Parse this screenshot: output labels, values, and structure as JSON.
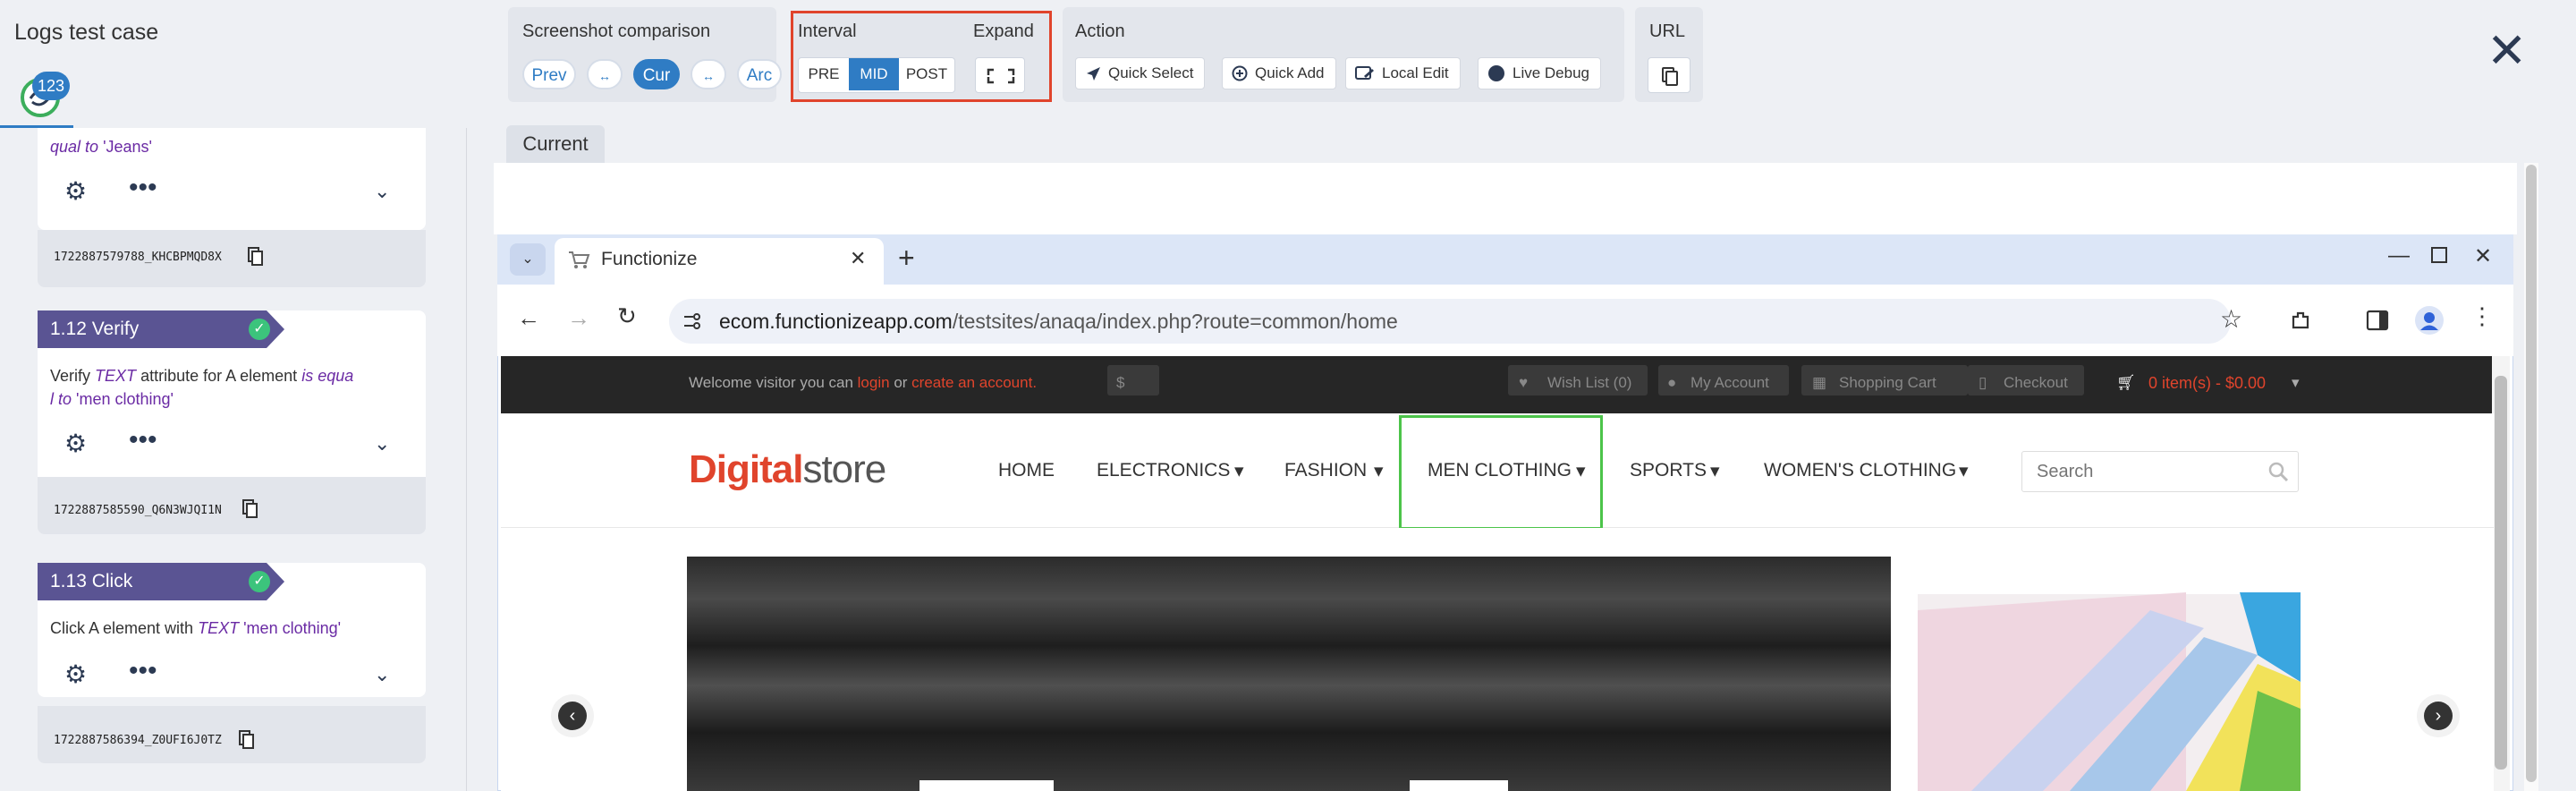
{
  "app": {
    "title": "Logs test case",
    "badge_count": "123"
  },
  "toolbar": {
    "comparison": {
      "title": "Screenshot comparison",
      "prev": "Prev",
      "cur": "Cur",
      "arc": "Arc",
      "swap_icon": "↔"
    },
    "interval": {
      "title": "Interval",
      "pre": "PRE",
      "mid": "MID",
      "post": "POST"
    },
    "expand": {
      "title": "Expand"
    },
    "action": {
      "title": "Action",
      "quick_select": "Quick Select",
      "quick_add": "Quick Add",
      "local_edit": "Local Edit",
      "live_debug": "Live Debug"
    },
    "url": {
      "title": "URL"
    }
  },
  "steps": [
    {
      "label": "",
      "desc_partial": "qual to",
      "desc_value": "'Jeans'",
      "id": "1722887579788_KHCBPMQD8X"
    },
    {
      "label": "1.12 Verify",
      "desc_prefix": "Verify",
      "desc_type": "TEXT",
      "desc_mid": "attribute for A  element",
      "desc_rel1": "is equa",
      "desc_rel2": "l to",
      "desc_value": "'men clothing'",
      "id": "1722887585590_Q6N3WJQI1N"
    },
    {
      "label": "1.13 Click",
      "desc_prefix": "Click A  element with",
      "desc_type": "TEXT",
      "desc_value": "'men clothing'",
      "id": "1722887586394_Z0UFI6J0TZ"
    }
  ],
  "main": {
    "tab_current": "Current"
  },
  "browser": {
    "tab_title": "Functionize",
    "url": "ecom.functionizeapp.com/testsites/anaqa/index.php?route=common/home",
    "url_domain": "ecom.functionizeapp.com",
    "url_path": "/testsites/anaqa/index.php?route=common/home"
  },
  "site": {
    "welcome": "Welcome visitor you can",
    "login": "login",
    "or": "or",
    "create": "create an account.",
    "currency": "$",
    "wishlist": "Wish List (0)",
    "account": "My Account",
    "cart_link": "Shopping Cart",
    "checkout": "Checkout",
    "cart": "0 item(s) - $0.00",
    "logo_bold": "Digital",
    "logo_light": "store",
    "nav": [
      "HOME",
      "ELECTRONICS",
      "FASHION",
      "MEN CLOTHING",
      "SPORTS",
      "WOMEN'S CLOTHING"
    ],
    "search_placeholder": "Search"
  },
  "colors": {
    "accent": "#2f7cc4",
    "step_label": "#5a5493",
    "highlight_red": "#e0442c",
    "highlight_green": "#4cc44a",
    "site_link": "#e0442c"
  }
}
